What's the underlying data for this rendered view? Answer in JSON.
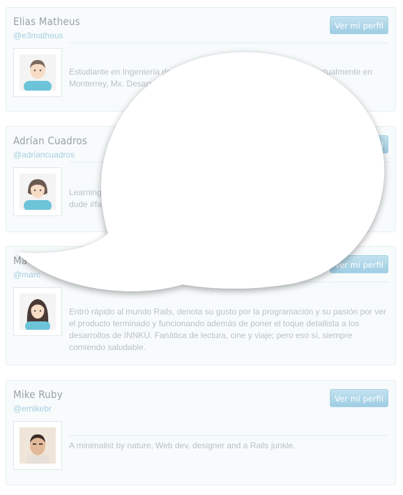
{
  "profiles": [
    {
      "name": "Elias Matheus",
      "handle": "@e3matheus",
      "button_label": "Ver mi perfil",
      "bio": "Estudiante en Ingeniería de C                                                          Actualmente en Monterrey, Mx. Desarrolla"
    },
    {
      "name": "Adrían Cuadros",
      "handle": "@adriancuadros",
      "button_label": "Ver mi perfil",
      "bio": "Learning\ndude #fa"
    },
    {
      "name": "Ma          Sánch",
      "handle": "@marc",
      "button_label": "Ver mi perfil",
      "bio": "Entró rápido al mundo Rails, denota su gusto por la programación y su pasión por ver el producto terminado y funcionando además de poner el toque detallista a los desarrollos de INNKU. Fanática de lectura, cine y viaje; pero eso sí, siempre comiendo saludable."
    },
    {
      "name": "Mike Ruby",
      "handle": "@emikebr",
      "button_label": "Ver mi perfil",
      "bio": "A minimalist by nature, Web dev, designer and a Rails junkle."
    }
  ],
  "colors": {
    "accent": "#a8d3e6",
    "name_text": "#9aa1a5",
    "handle_text": "#a8cfe0",
    "bio_text": "#b9c2c6"
  },
  "icons": {
    "bubble": "speech-bubble-overlay"
  }
}
